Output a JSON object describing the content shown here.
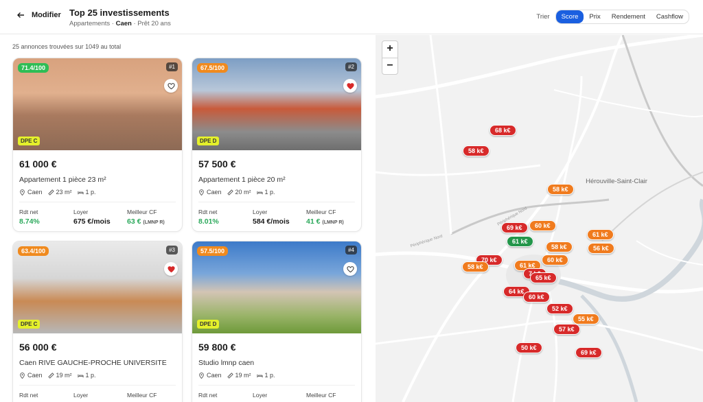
{
  "header": {
    "back_label": "Modifier",
    "title": "Top 25 investissements",
    "subtitle_prefix": "Appartements · ",
    "subtitle_city": "Caen",
    "subtitle_suffix": " · Prêt 20 ans",
    "sort_label": "Trier",
    "sort_options": [
      "Score",
      "Prix",
      "Rendement",
      "Cashflow"
    ],
    "sort_active": "Score"
  },
  "results": {
    "count_text": "25 annonces trouvées sur 1049 au total",
    "cards": [
      {
        "score": "71.4/100",
        "score_color": "#2ebd55",
        "rank": "#1",
        "favorite": false,
        "dpe": "DPE C",
        "price": "61 000 €",
        "title": "Appartement 1 pièce 23 m²",
        "city": "Caen",
        "area": "23 m²",
        "rooms": "1 p.",
        "rdt_label": "Rdt net",
        "rdt": "8.74%",
        "loyer_label": "Loyer",
        "loyer": "675 €/mois",
        "cf_label": "Meilleur CF",
        "cf": "63 €",
        "cf_regime": "(LMNP R)"
      },
      {
        "score": "67.5/100",
        "score_color": "#f08a1e",
        "rank": "#2",
        "favorite": true,
        "dpe": "DPE D",
        "price": "57 500 €",
        "title": "Appartement 1 pièce 20 m²",
        "city": "Caen",
        "area": "20 m²",
        "rooms": "1 p.",
        "rdt_label": "Rdt net",
        "rdt": "8.01%",
        "loyer_label": "Loyer",
        "loyer": "584 €/mois",
        "cf_label": "Meilleur CF",
        "cf": "41 €",
        "cf_regime": "(LMNP R)"
      },
      {
        "score": "63.4/100",
        "score_color": "#f08a1e",
        "rank": "#3",
        "favorite": true,
        "dpe": "DPE C",
        "price": "56 000 €",
        "title": "Caen RIVE GAUCHE-PROCHE UNIVERSITE",
        "city": "Caen",
        "area": "19 m²",
        "rooms": "1 p.",
        "rdt_label": "Rdt net",
        "rdt": "",
        "loyer_label": "Loyer",
        "loyer": "",
        "cf_label": "Meilleur CF",
        "cf": "",
        "cf_regime": ""
      },
      {
        "score": "57.5/100",
        "score_color": "#f08a1e",
        "rank": "#4",
        "favorite": false,
        "dpe": "DPE D",
        "price": "59 800 €",
        "title": "Studio lmnp caen",
        "city": "Caen",
        "area": "19 m²",
        "rooms": "1 p.",
        "rdt_label": "Rdt net",
        "rdt": "",
        "loyer_label": "Loyer",
        "loyer": "",
        "cf_label": "Meilleur CF",
        "cf": "",
        "cf_regime": ""
      }
    ]
  },
  "map": {
    "zoom_in": "+",
    "zoom_out": "−",
    "place_label": "Hérouville-Saint-Clair",
    "road_label": "Périphérique Nord",
    "markers": [
      {
        "label": "68 k€",
        "color": "red"
      },
      {
        "label": "58 k€",
        "color": "red"
      },
      {
        "label": "58 k€",
        "color": "orange"
      },
      {
        "label": "60 k€",
        "color": "orange"
      },
      {
        "label": "69 k€",
        "color": "red"
      },
      {
        "label": "61 k€",
        "color": "orange"
      },
      {
        "label": "61 k€",
        "color": "green"
      },
      {
        "label": "58 k€",
        "color": "orange"
      },
      {
        "label": "56 k€",
        "color": "orange"
      },
      {
        "label": "70 k€",
        "color": "red"
      },
      {
        "label": "60 k€",
        "color": "orange"
      },
      {
        "label": "58 k€",
        "color": "orange"
      },
      {
        "label": "61 k€",
        "color": "orange"
      },
      {
        "label": "7 k€",
        "color": "red"
      },
      {
        "label": "65 k€",
        "color": "red"
      },
      {
        "label": "64 k€",
        "color": "red"
      },
      {
        "label": "60 k€",
        "color": "red"
      },
      {
        "label": "52 k€",
        "color": "red"
      },
      {
        "label": "55 k€",
        "color": "orange"
      },
      {
        "label": "57 k€",
        "color": "red"
      },
      {
        "label": "50 k€",
        "color": "red"
      },
      {
        "label": "69 k€",
        "color": "red"
      }
    ]
  }
}
